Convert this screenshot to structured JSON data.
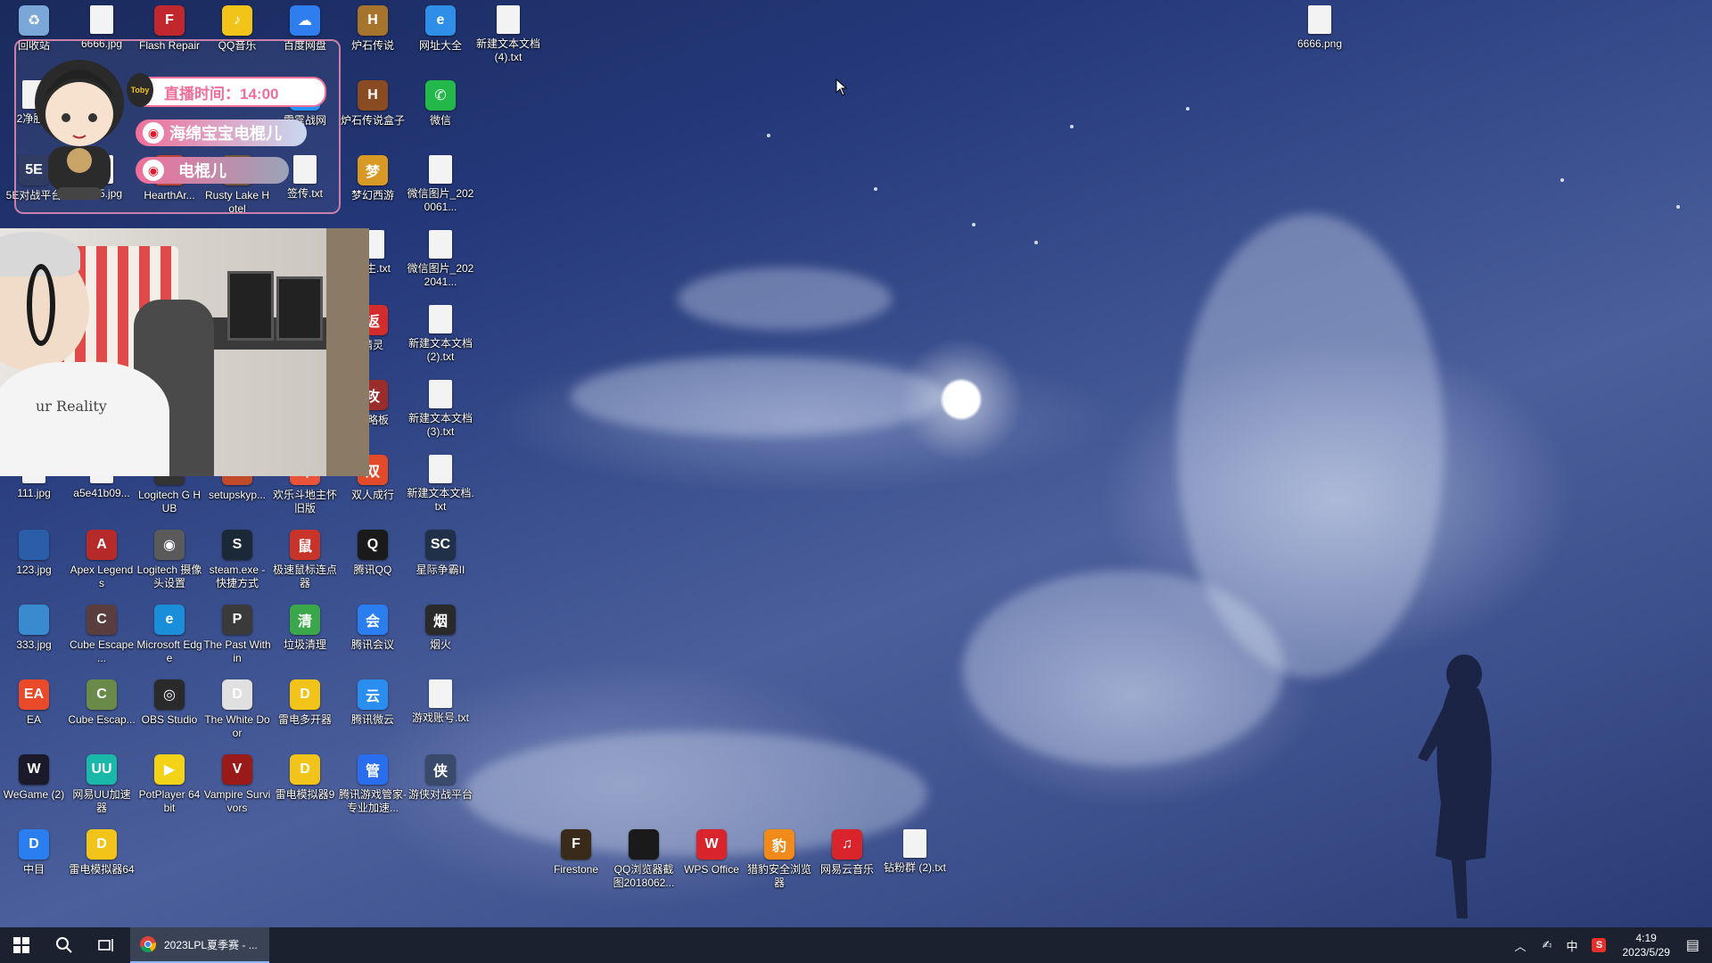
{
  "desktop": {
    "icons": [
      {
        "label": "回收站",
        "icon": "recycle-bin-icon",
        "color": "#7aa7d8",
        "glyph": "♻",
        "file": false
      },
      {
        "label": "6666.jpg",
        "icon": "image-file-icon",
        "color": "#f3f3f3",
        "glyph": "",
        "file": true
      },
      {
        "label": "Flash Repair",
        "icon": "flash-repair-icon",
        "color": "#c0282d",
        "glyph": "F",
        "file": false
      },
      {
        "label": "QQ音乐",
        "icon": "qq-music-icon",
        "color": "#f2c318",
        "glyph": "♪",
        "file": false
      },
      {
        "label": "百度网盘",
        "icon": "baidu-netdisk-icon",
        "color": "#2f7ef0",
        "glyph": "☁",
        "file": false
      },
      {
        "label": "炉石传说",
        "icon": "hearthstone-icon",
        "color": "#a6742c",
        "glyph": "H",
        "file": false
      },
      {
        "label": "网址大全",
        "icon": "browser-icon",
        "color": "#2e8ee8",
        "glyph": "e",
        "file": false
      },
      {
        "label": "新建文本文档 (4).txt",
        "icon": "text-file-icon",
        "color": "#f3f3f3",
        "glyph": "",
        "file": true
      },
      {
        "label": "2净胜S",
        "icon": "image-file-icon",
        "color": "#f3f3f3",
        "glyph": "",
        "file": true
      },
      {
        "label": "雷霆战网",
        "icon": "battle-net-icon",
        "color": "#148eff",
        "glyph": "B",
        "file": false
      },
      {
        "label": "炉石传说盒子",
        "icon": "hearthstone-box-icon",
        "color": "#8a4a22",
        "glyph": "H",
        "file": false
      },
      {
        "label": "微信",
        "icon": "wechat-icon",
        "color": "#22b84a",
        "glyph": "✆",
        "file": false
      },
      {
        "label": "5E对战平台",
        "icon": "5e-platform-icon",
        "color": "#25305a",
        "glyph": "5E",
        "file": false
      },
      {
        "label": "5555.jpg",
        "icon": "image-file-icon",
        "color": "#f3f3f3",
        "glyph": "",
        "file": true
      },
      {
        "label": "HearthAr...",
        "icon": "hearth-arena-icon",
        "color": "#b63a2a",
        "glyph": "A",
        "file": false
      },
      {
        "label": "Rusty Lake Hotel",
        "icon": "rusty-lake-icon",
        "color": "#6a4b2e",
        "glyph": "R",
        "file": false
      },
      {
        "label": "签传.txt",
        "icon": "text-file-icon",
        "color": "#f3f3f3",
        "glyph": "",
        "file": true
      },
      {
        "label": "梦幻西游",
        "icon": "menghuan-xiyou-icon",
        "color": "#d89a24",
        "glyph": "梦",
        "file": false
      },
      {
        "label": "微信图片_2020061...",
        "icon": "image-file-icon",
        "color": "#e7e7e7",
        "glyph": "",
        "file": true
      },
      {
        "label": "签生.txt",
        "icon": "text-file-icon",
        "color": "#f3f3f3",
        "glyph": "",
        "file": true
      },
      {
        "label": "微信图片_2022041...",
        "icon": "image-file-icon",
        "color": "#e7d7df",
        "glyph": "",
        "file": true
      },
      {
        "label": "精灵",
        "icon": "app-red-icon",
        "color": "#d22c2c",
        "glyph": "返",
        "file": false
      },
      {
        "label": "新建文本文档 (2).txt",
        "icon": "text-file-icon",
        "color": "#f3f3f3",
        "glyph": "",
        "file": true
      },
      {
        "label": "攻略板",
        "icon": "app-guide-icon",
        "color": "#9a2c2c",
        "glyph": "攻",
        "file": false
      },
      {
        "label": "新建文本文档 (3).txt",
        "icon": "text-file-icon",
        "color": "#f3f3f3",
        "glyph": "",
        "file": true
      },
      {
        "label": "111.jpg",
        "icon": "image-file-icon",
        "color": "#f3f3f3",
        "glyph": "",
        "file": true
      },
      {
        "label": "a5e41b09...",
        "icon": "image-file-icon",
        "color": "#f3f3f3",
        "glyph": "",
        "file": true
      },
      {
        "label": "Logitech G HUB",
        "icon": "logitech-ghub-icon",
        "color": "#333333",
        "glyph": "G",
        "file": false
      },
      {
        "label": "setupskyp...",
        "icon": "setup-icon",
        "color": "#c04a2a",
        "glyph": "S",
        "file": false
      },
      {
        "label": "欢乐斗地主怀旧版",
        "icon": "doudizhu-icon",
        "color": "#e8533a",
        "glyph": "斗",
        "file": false
      },
      {
        "label": "双人成行",
        "icon": "it-takes-two-icon",
        "color": "#e24a2a",
        "glyph": "双",
        "file": false
      },
      {
        "label": "新建文本文档.txt",
        "icon": "text-file-icon",
        "color": "#f3f3f3",
        "glyph": "",
        "file": true
      },
      {
        "label": "123.jpg",
        "icon": "image-file-icon",
        "color": "#2a5ea8",
        "glyph": "",
        "file": false
      },
      {
        "label": "Apex Legends",
        "icon": "apex-legends-icon",
        "color": "#b62a2a",
        "glyph": "A",
        "file": false
      },
      {
        "label": "Logitech 摄像头设置",
        "icon": "logitech-camera-icon",
        "color": "#5a5a5a",
        "glyph": "◉",
        "file": false
      },
      {
        "label": "steam.exe - 快捷方式",
        "icon": "steam-icon",
        "color": "#1b2838",
        "glyph": "S",
        "file": false
      },
      {
        "label": "极速鼠标连点器",
        "icon": "mouse-clicker-icon",
        "color": "#c8342a",
        "glyph": "鼠",
        "file": false
      },
      {
        "label": "腾讯QQ",
        "icon": "tencent-qq-icon",
        "color": "#1a1a1a",
        "glyph": "Q",
        "file": false
      },
      {
        "label": "星际争霸II",
        "icon": "starcraft-icon",
        "color": "#203049",
        "glyph": "SC",
        "file": false
      },
      {
        "label": "333.jpg",
        "icon": "image-file-icon",
        "color": "#3a8ad0",
        "glyph": "",
        "file": false
      },
      {
        "label": "Cube Escape ...",
        "icon": "cube-escape-icon",
        "color": "#5a3e3e",
        "glyph": "C",
        "file": false
      },
      {
        "label": "Microsoft Edge",
        "icon": "edge-icon",
        "color": "#1a8ed8",
        "glyph": "e",
        "file": false
      },
      {
        "label": "The Past Within",
        "icon": "past-within-icon",
        "color": "#3a3a3a",
        "glyph": "P",
        "file": false
      },
      {
        "label": "垃圾清理",
        "icon": "cleaner-icon",
        "color": "#3aa84a",
        "glyph": "清",
        "file": false
      },
      {
        "label": "腾讯会议",
        "icon": "tencent-meeting-icon",
        "color": "#2a7ef0",
        "glyph": "会",
        "file": false
      },
      {
        "label": "烟火",
        "icon": "yanhuo-icon",
        "color": "#2a2a2a",
        "glyph": "烟",
        "file": false
      },
      {
        "label": "EA",
        "icon": "ea-icon",
        "color": "#e84a2a",
        "glyph": "EA",
        "file": false
      },
      {
        "label": "Cube Escap...",
        "icon": "cube-escape-icon",
        "color": "#6a8a4a",
        "glyph": "C",
        "file": false
      },
      {
        "label": "OBS Studio",
        "icon": "obs-studio-icon",
        "color": "#2a2a2a",
        "glyph": "◎",
        "file": false
      },
      {
        "label": "The White Door",
        "icon": "white-door-icon",
        "color": "#e0e0e0",
        "glyph": "D",
        "file": false
      },
      {
        "label": "雷电多开器",
        "icon": "leidian-multi-icon",
        "color": "#f2c318",
        "glyph": "D",
        "file": false
      },
      {
        "label": "腾讯微云",
        "icon": "weiyun-icon",
        "color": "#2a8ef0",
        "glyph": "云",
        "file": false
      },
      {
        "label": "游戏账号.txt",
        "icon": "text-file-icon",
        "color": "#f3f3f3",
        "glyph": "",
        "file": true
      },
      {
        "label": "WeGame (2)",
        "icon": "wegame-icon",
        "color": "#1a1a2a",
        "glyph": "W",
        "file": false
      },
      {
        "label": "网易UU加速器",
        "icon": "uu-accelerator-icon",
        "color": "#1ab8a8",
        "glyph": "UU",
        "file": false
      },
      {
        "label": "PotPlayer 64 bit",
        "icon": "potplayer-icon",
        "color": "#f2d318",
        "glyph": "▶",
        "file": false
      },
      {
        "label": "Vampire Survivors",
        "icon": "vampire-survivors-icon",
        "color": "#9a1a1a",
        "glyph": "V",
        "file": false
      },
      {
        "label": "雷电模拟器9",
        "icon": "leidian-emulator-icon",
        "color": "#f2c318",
        "glyph": "D",
        "file": false
      },
      {
        "label": "腾讯游戏管家-专业加速...",
        "icon": "tencent-game-manager-icon",
        "color": "#2a6ef0",
        "glyph": "管",
        "file": false
      },
      {
        "label": "游侠对战平台",
        "icon": "youxia-platform-icon",
        "color": "#3a4a6a",
        "glyph": "侠",
        "file": false
      },
      {
        "label": "中目",
        "icon": "zhongmu-icon",
        "color": "#2a7ef0",
        "glyph": "D",
        "file": false
      },
      {
        "label": "雷电模拟器64",
        "icon": "leidian-emulator-icon",
        "color": "#f2c318",
        "glyph": "D",
        "file": false
      },
      {
        "label": "Firestone",
        "icon": "firestone-icon",
        "color": "#3a2a1a",
        "glyph": "F",
        "file": false
      },
      {
        "label": "QQ浏览器截图2018062...",
        "icon": "image-file-icon",
        "color": "#1a1a1a",
        "glyph": "",
        "file": false
      },
      {
        "label": "WPS Office",
        "icon": "wps-office-icon",
        "color": "#d8242a",
        "glyph": "W",
        "file": false
      },
      {
        "label": "猎豹安全浏览器",
        "icon": "cheetah-browser-icon",
        "color": "#f28a1a",
        "glyph": "豹",
        "file": false
      },
      {
        "label": "网易云音乐",
        "icon": "netease-music-icon",
        "color": "#d8242a",
        "glyph": "♫",
        "file": false
      },
      {
        "label": "钻粉群 (2).txt",
        "icon": "text-file-icon",
        "color": "#f3f3f3",
        "glyph": "",
        "file": true
      },
      {
        "label": "6666.png",
        "icon": "image-file-icon",
        "color": "#f3f3f3",
        "glyph": "",
        "file": true
      }
    ]
  },
  "overlay": {
    "live_time": "直播时间：14:00",
    "brand_1": "海绵宝宝电棍儿",
    "brand_2": "电棍儿",
    "badge_text": "Toby"
  },
  "webcam": {
    "shirt_text": "ur Reality"
  },
  "taskbar": {
    "active_app_title": "2023LPL夏季赛 - ...",
    "tray_ime": "中",
    "time": "4:19",
    "date": "2023/5/29"
  },
  "colors": {
    "taskbar_bg": "#1c2130",
    "pill_pink": "#f06f9a",
    "pill_dark": "#3a3a4a",
    "weibo_red": "#e6162d"
  }
}
